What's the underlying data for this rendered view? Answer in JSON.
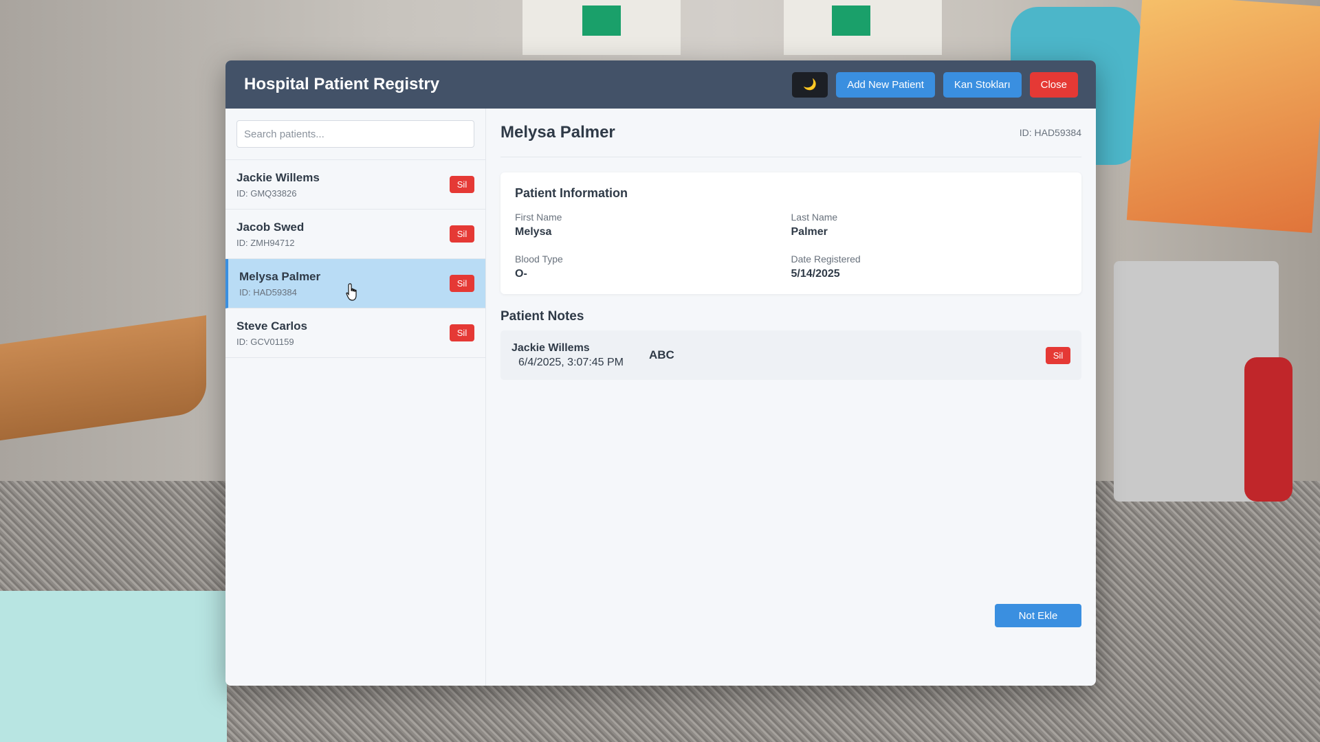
{
  "window": {
    "title": "Hospital Patient Registry",
    "theme_toggle_icon": "moon-icon",
    "buttons": {
      "theme": "🌙",
      "add_patient": "Add New Patient",
      "blood_stock": "Kan Stokları",
      "close": "Close"
    }
  },
  "sidebar": {
    "search_placeholder": "Search patients...",
    "patients": [
      {
        "name": "Jackie Willems",
        "id": "ID: GMQ33826",
        "delete_label": "Sil"
      },
      {
        "name": "Jacob Swed",
        "id": "ID: ZMH94712",
        "delete_label": "Sil"
      },
      {
        "name": "Melysa Palmer",
        "id": "ID: HAD59384",
        "delete_label": "Sil",
        "active": true
      },
      {
        "name": "Steve Carlos",
        "id": "ID: GCV01159",
        "delete_label": "Sil"
      }
    ]
  },
  "detail": {
    "name": "Melysa Palmer",
    "id": "ID: HAD59384",
    "info_title": "Patient Information",
    "fields": {
      "first_name_label": "First Name",
      "first_name": "Melysa",
      "last_name_label": "Last Name",
      "last_name": "Palmer",
      "blood_type_label": "Blood Type",
      "blood_type": "O-",
      "date_registered_label": "Date Registered",
      "date_registered": "5/14/2025"
    },
    "notes_title": "Patient Notes",
    "notes": [
      {
        "author": "Jackie Willems",
        "date": "6/4/2025, 3:07:45 PM",
        "text": "ABC",
        "delete_label": "Sil"
      }
    ],
    "add_note_label": "Not Ekle"
  },
  "colors": {
    "header_bg": "#435268",
    "primary": "#3a8fe0",
    "danger": "#e53935",
    "active_row": "#b9dcf5"
  }
}
